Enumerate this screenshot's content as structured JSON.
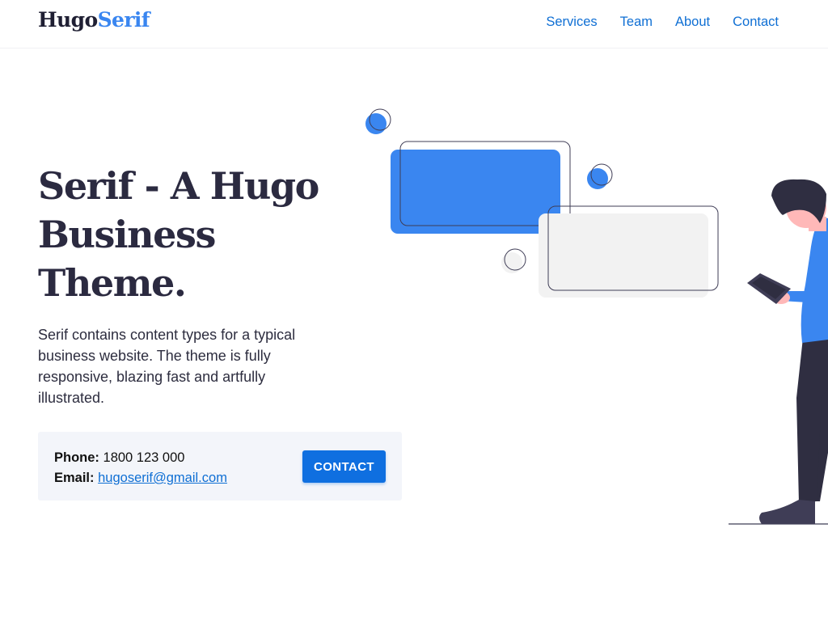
{
  "header": {
    "logo_main": "Hugo",
    "logo_accent": "Serif",
    "nav": [
      {
        "label": "Services"
      },
      {
        "label": "Team"
      },
      {
        "label": "About"
      },
      {
        "label": "Contact"
      }
    ]
  },
  "hero": {
    "title_line1": "Serif - A Hugo",
    "title_line2": "Business",
    "title_line3": "Theme.",
    "description": "Serif contains content types for a typical business website. The theme is fully responsive, blazing fast and artfully illustrated."
  },
  "contact": {
    "phone_label": "Phone:",
    "phone_value": "1800 123 000",
    "email_label": "Email:",
    "email_value": "hugoserif@gmail.com",
    "button_label": "CONTACT"
  },
  "colors": {
    "accent": "#3a86f0",
    "link": "#0f6fd4",
    "button": "#0f6fe0",
    "heading": "#2b2a40",
    "box_bg": "#f3f5fa",
    "illustration_dark": "#2f2e41",
    "illustration_skin": "#ffb8b8"
  }
}
